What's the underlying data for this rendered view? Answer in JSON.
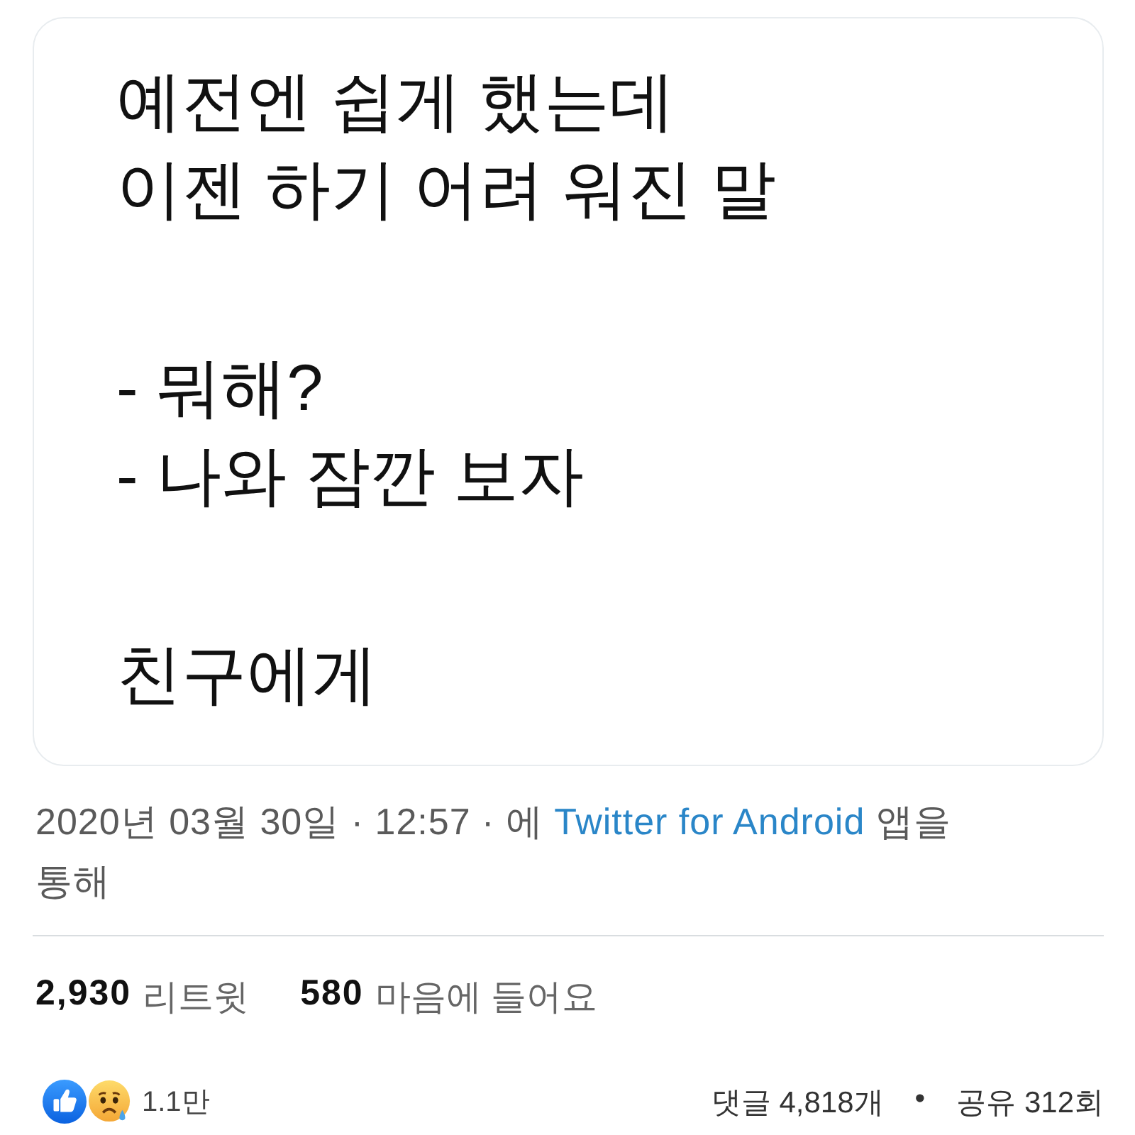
{
  "tweet": {
    "paragraphs": [
      [
        "예전엔 쉽게 했는데",
        "이젠 하기 어려 워진 말"
      ],
      [
        "- 뭐해?",
        "- 나와 잠깐 보자"
      ],
      [
        "친구에게"
      ]
    ]
  },
  "meta": {
    "lead": "2020년 03월 30일 · 12:57 · 에",
    "source_link": "Twitter for Android",
    "trail": "앱을 통해"
  },
  "stats": [
    {
      "count": "2,930",
      "label": "리트윗"
    },
    {
      "count": "580",
      "label": "마음에 들어요"
    }
  ],
  "reactions": {
    "icons": [
      {
        "kind": "like"
      },
      {
        "kind": "sad"
      }
    ],
    "count": "1.1만"
  },
  "engagement": {
    "comments": "댓글 4,818개",
    "separator": "•",
    "shares": "공유 312회"
  }
}
